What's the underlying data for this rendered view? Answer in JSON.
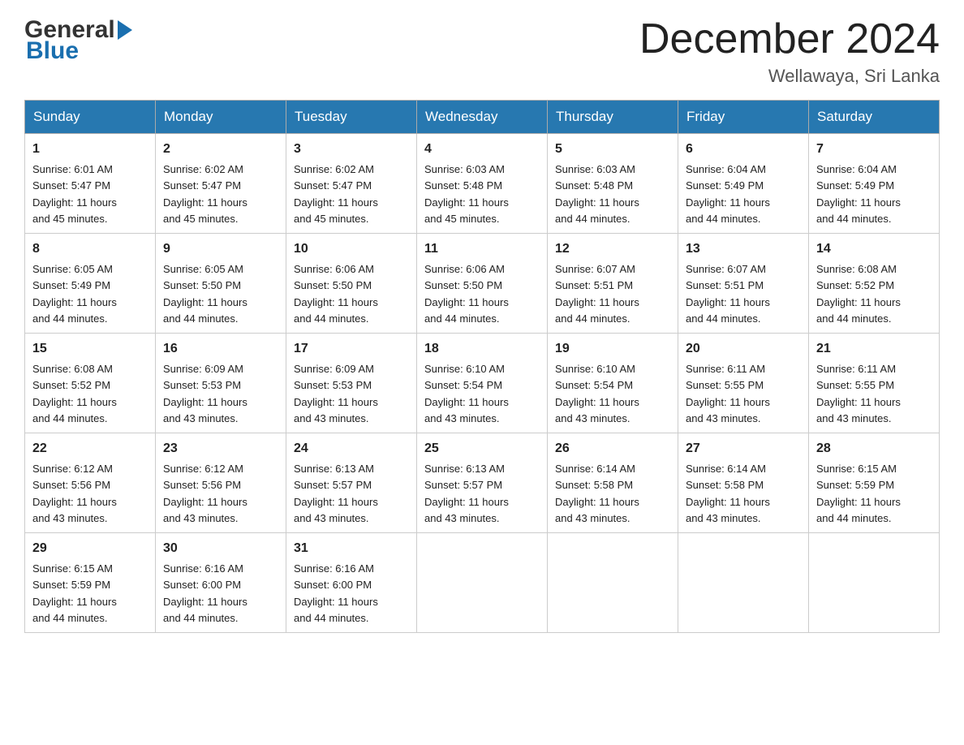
{
  "header": {
    "logo": {
      "general": "General",
      "blue": "Blue"
    },
    "title": "December 2024",
    "location": "Wellawaya, Sri Lanka"
  },
  "calendar": {
    "days_of_week": [
      "Sunday",
      "Monday",
      "Tuesday",
      "Wednesday",
      "Thursday",
      "Friday",
      "Saturday"
    ],
    "weeks": [
      [
        {
          "num": "1",
          "sunrise": "6:01 AM",
          "sunset": "5:47 PM",
          "daylight": "11 hours and 45 minutes."
        },
        {
          "num": "2",
          "sunrise": "6:02 AM",
          "sunset": "5:47 PM",
          "daylight": "11 hours and 45 minutes."
        },
        {
          "num": "3",
          "sunrise": "6:02 AM",
          "sunset": "5:47 PM",
          "daylight": "11 hours and 45 minutes."
        },
        {
          "num": "4",
          "sunrise": "6:03 AM",
          "sunset": "5:48 PM",
          "daylight": "11 hours and 45 minutes."
        },
        {
          "num": "5",
          "sunrise": "6:03 AM",
          "sunset": "5:48 PM",
          "daylight": "11 hours and 44 minutes."
        },
        {
          "num": "6",
          "sunrise": "6:04 AM",
          "sunset": "5:49 PM",
          "daylight": "11 hours and 44 minutes."
        },
        {
          "num": "7",
          "sunrise": "6:04 AM",
          "sunset": "5:49 PM",
          "daylight": "11 hours and 44 minutes."
        }
      ],
      [
        {
          "num": "8",
          "sunrise": "6:05 AM",
          "sunset": "5:49 PM",
          "daylight": "11 hours and 44 minutes."
        },
        {
          "num": "9",
          "sunrise": "6:05 AM",
          "sunset": "5:50 PM",
          "daylight": "11 hours and 44 minutes."
        },
        {
          "num": "10",
          "sunrise": "6:06 AM",
          "sunset": "5:50 PM",
          "daylight": "11 hours and 44 minutes."
        },
        {
          "num": "11",
          "sunrise": "6:06 AM",
          "sunset": "5:50 PM",
          "daylight": "11 hours and 44 minutes."
        },
        {
          "num": "12",
          "sunrise": "6:07 AM",
          "sunset": "5:51 PM",
          "daylight": "11 hours and 44 minutes."
        },
        {
          "num": "13",
          "sunrise": "6:07 AM",
          "sunset": "5:51 PM",
          "daylight": "11 hours and 44 minutes."
        },
        {
          "num": "14",
          "sunrise": "6:08 AM",
          "sunset": "5:52 PM",
          "daylight": "11 hours and 44 minutes."
        }
      ],
      [
        {
          "num": "15",
          "sunrise": "6:08 AM",
          "sunset": "5:52 PM",
          "daylight": "11 hours and 44 minutes."
        },
        {
          "num": "16",
          "sunrise": "6:09 AM",
          "sunset": "5:53 PM",
          "daylight": "11 hours and 43 minutes."
        },
        {
          "num": "17",
          "sunrise": "6:09 AM",
          "sunset": "5:53 PM",
          "daylight": "11 hours and 43 minutes."
        },
        {
          "num": "18",
          "sunrise": "6:10 AM",
          "sunset": "5:54 PM",
          "daylight": "11 hours and 43 minutes."
        },
        {
          "num": "19",
          "sunrise": "6:10 AM",
          "sunset": "5:54 PM",
          "daylight": "11 hours and 43 minutes."
        },
        {
          "num": "20",
          "sunrise": "6:11 AM",
          "sunset": "5:55 PM",
          "daylight": "11 hours and 43 minutes."
        },
        {
          "num": "21",
          "sunrise": "6:11 AM",
          "sunset": "5:55 PM",
          "daylight": "11 hours and 43 minutes."
        }
      ],
      [
        {
          "num": "22",
          "sunrise": "6:12 AM",
          "sunset": "5:56 PM",
          "daylight": "11 hours and 43 minutes."
        },
        {
          "num": "23",
          "sunrise": "6:12 AM",
          "sunset": "5:56 PM",
          "daylight": "11 hours and 43 minutes."
        },
        {
          "num": "24",
          "sunrise": "6:13 AM",
          "sunset": "5:57 PM",
          "daylight": "11 hours and 43 minutes."
        },
        {
          "num": "25",
          "sunrise": "6:13 AM",
          "sunset": "5:57 PM",
          "daylight": "11 hours and 43 minutes."
        },
        {
          "num": "26",
          "sunrise": "6:14 AM",
          "sunset": "5:58 PM",
          "daylight": "11 hours and 43 minutes."
        },
        {
          "num": "27",
          "sunrise": "6:14 AM",
          "sunset": "5:58 PM",
          "daylight": "11 hours and 43 minutes."
        },
        {
          "num": "28",
          "sunrise": "6:15 AM",
          "sunset": "5:59 PM",
          "daylight": "11 hours and 44 minutes."
        }
      ],
      [
        {
          "num": "29",
          "sunrise": "6:15 AM",
          "sunset": "5:59 PM",
          "daylight": "11 hours and 44 minutes."
        },
        {
          "num": "30",
          "sunrise": "6:16 AM",
          "sunset": "6:00 PM",
          "daylight": "11 hours and 44 minutes."
        },
        {
          "num": "31",
          "sunrise": "6:16 AM",
          "sunset": "6:00 PM",
          "daylight": "11 hours and 44 minutes."
        },
        null,
        null,
        null,
        null
      ]
    ],
    "sunrise_label": "Sunrise:",
    "sunset_label": "Sunset:",
    "daylight_label": "Daylight:"
  }
}
